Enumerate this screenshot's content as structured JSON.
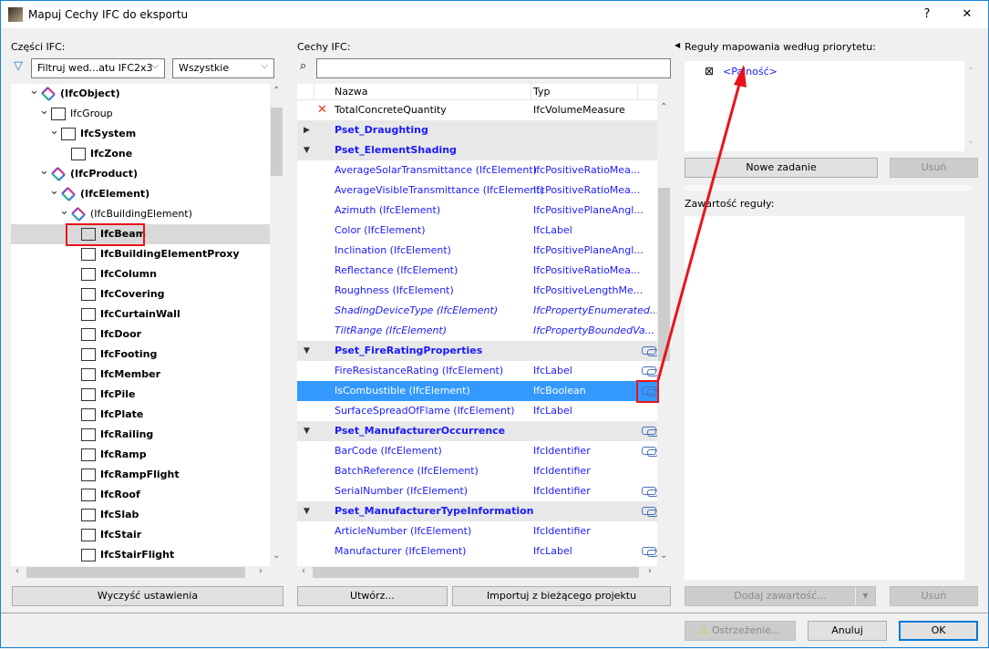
{
  "window": {
    "title": "Mapuj Cechy IFC do eksportu",
    "help": "?",
    "close": "✕"
  },
  "left": {
    "label": "Części IFC:",
    "filter_dropdown": "Filtruj wed...atu IFC2x3",
    "scope_dropdown": "Wszystkie",
    "tree": [
      {
        "label": "(IfcObject)",
        "level": 0,
        "expanded": true,
        "icon": "ifc-logo-icon"
      },
      {
        "label": "IfcGroup",
        "level": 1,
        "expanded": true,
        "icon": "group-icon",
        "normal": true
      },
      {
        "label": "IfcSystem",
        "level": 2,
        "expanded": true,
        "icon": "system-icon"
      },
      {
        "label": "IfcZone",
        "level": 3,
        "icon": "zone-icon"
      },
      {
        "label": "(IfcProduct)",
        "level": 1,
        "expanded": true,
        "icon": "ifc-logo-icon"
      },
      {
        "label": "(IfcElement)",
        "level": 2,
        "expanded": true,
        "icon": "ifc-logo-icon"
      },
      {
        "label": "(IfcBuildingElement)",
        "level": 3,
        "expanded": true,
        "icon": "ifc-logo-icon",
        "normal": true
      },
      {
        "label": "IfcBeam",
        "level": 4,
        "icon": "beam-icon",
        "selected": true
      },
      {
        "label": "IfcBuildingElementProxy",
        "level": 4,
        "icon": "proxy-icon"
      },
      {
        "label": "IfcColumn",
        "level": 4,
        "icon": "column-icon"
      },
      {
        "label": "IfcCovering",
        "level": 4,
        "icon": "covering-icon"
      },
      {
        "label": "IfcCurtainWall",
        "level": 4,
        "icon": "curtain-wall-icon"
      },
      {
        "label": "IfcDoor",
        "level": 4,
        "icon": "door-icon"
      },
      {
        "label": "IfcFooting",
        "level": 4,
        "icon": "footing-icon"
      },
      {
        "label": "IfcMember",
        "level": 4,
        "icon": "member-icon"
      },
      {
        "label": "IfcPile",
        "level": 4,
        "icon": "pile-icon"
      },
      {
        "label": "IfcPlate",
        "level": 4,
        "icon": "plate-icon"
      },
      {
        "label": "IfcRailing",
        "level": 4,
        "icon": "railing-icon"
      },
      {
        "label": "IfcRamp",
        "level": 4,
        "icon": "ramp-icon"
      },
      {
        "label": "IfcRampFlight",
        "level": 4,
        "icon": "ramp-flight-icon"
      },
      {
        "label": "IfcRoof",
        "level": 4,
        "icon": "roof-icon"
      },
      {
        "label": "IfcSlab",
        "level": 4,
        "icon": "slab-icon"
      },
      {
        "label": "IfcStair",
        "level": 4,
        "icon": "stair-icon"
      },
      {
        "label": "IfcStairFlight",
        "level": 4,
        "icon": "stair-flight-icon"
      }
    ],
    "clear_button": "Wyczyść ustawienia"
  },
  "middle": {
    "label": "Cechy IFC:",
    "search_value": "",
    "columns": [
      "Nazwa",
      "Typ"
    ],
    "rows": [
      {
        "kind": "removed",
        "name": "TotalConcreteQuantity",
        "type": "IfcVolumeMeasure"
      },
      {
        "kind": "group",
        "name": "Pset_Draughting",
        "expanded": false
      },
      {
        "kind": "group",
        "name": "Pset_ElementShading",
        "expanded": true
      },
      {
        "kind": "item",
        "name": "AverageSolarTransmittance (IfcElement)",
        "type": "IfcPositiveRatioMea..."
      },
      {
        "kind": "item",
        "name": "AverageVisibleTransmittance (IfcElement)",
        "type": "IfcPositiveRatioMea..."
      },
      {
        "kind": "item",
        "name": "Azimuth (IfcElement)",
        "type": "IfcPositivePlaneAngl..."
      },
      {
        "kind": "item",
        "name": "Color (IfcElement)",
        "type": "IfcLabel"
      },
      {
        "kind": "item",
        "name": "Inclination (IfcElement)",
        "type": "IfcPositivePlaneAngl..."
      },
      {
        "kind": "item",
        "name": "Reflectance (IfcElement)",
        "type": "IfcPositiveRatioMea..."
      },
      {
        "kind": "item",
        "name": "Roughness (IfcElement)",
        "type": "IfcPositiveLengthMe..."
      },
      {
        "kind": "italic",
        "name": "ShadingDeviceType (IfcElement)",
        "type": "IfcPropertyEnumerated..."
      },
      {
        "kind": "italic",
        "name": "TiltRange (IfcElement)",
        "type": "IfcPropertyBoundedVa..."
      },
      {
        "kind": "group",
        "name": "Pset_FireRatingProperties",
        "expanded": true,
        "linked": true
      },
      {
        "kind": "item",
        "name": "FireResistanceRating (IfcElement)",
        "type": "IfcLabel",
        "linked": true
      },
      {
        "kind": "item",
        "name": "IsCombustible (IfcElement)",
        "type": "IfcBoolean",
        "linked": true,
        "selected": true
      },
      {
        "kind": "item",
        "name": "SurfaceSpreadOfFlame (IfcElement)",
        "type": "IfcLabel"
      },
      {
        "kind": "group",
        "name": "Pset_ManufacturerOccurrence",
        "expanded": true,
        "linked": true
      },
      {
        "kind": "item",
        "name": "BarCode (IfcElement)",
        "type": "IfcIdentifier",
        "linked": true
      },
      {
        "kind": "item",
        "name": "BatchReference (IfcElement)",
        "type": "IfcIdentifier"
      },
      {
        "kind": "item",
        "name": "SerialNumber (IfcElement)",
        "type": "IfcIdentifier",
        "linked": true
      },
      {
        "kind": "group",
        "name": "Pset_ManufacturerTypeInformation",
        "expanded": true,
        "linked": true
      },
      {
        "kind": "item",
        "name": "ArticleNumber (IfcElement)",
        "type": "IfcIdentifier"
      },
      {
        "kind": "item",
        "name": "Manufacturer (IfcElement)",
        "type": "IfcLabel",
        "linked": true
      }
    ],
    "create_button": "Utwórz...",
    "import_button": "Importuj z bieżącego projektu"
  },
  "right": {
    "rules_label": "Reguły mapowania według priorytetu:",
    "rules": [
      {
        "label": "<Palność>",
        "checked": true
      }
    ],
    "new_rule_button": "Nowe zadanie",
    "delete_rule_button": "Usuń",
    "content_label": "Zawartość reguły:",
    "add_content_button": "Dodaj zawartość...",
    "delete_content_button": "Usuń"
  },
  "footer": {
    "warning_button": "Ostrzeżenie...",
    "cancel_button": "Anuluj",
    "ok_button": "OK"
  },
  "colors": {
    "link_blue": "#1a1aff",
    "selection": "#3399ff",
    "annotation_red": "#e8141b"
  }
}
